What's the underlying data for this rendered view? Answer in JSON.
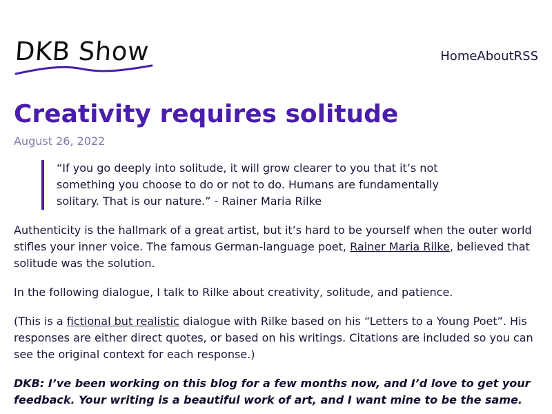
{
  "site": {
    "logo_text": "DKB Show",
    "accent_color": "#4a1dab",
    "text_color": "#1b1639",
    "muted_color": "#8577a8"
  },
  "nav": {
    "home": "Home",
    "about": "About",
    "rss": "RSS"
  },
  "post": {
    "title": "Creativity requires solitude",
    "date": "August 26, 2022",
    "quote": "“If you go deeply into solitude, it will grow clearer to you that it’s not something you choose to do or not to do. Humans are fundamentally solitary. That is our nature.” - Rainer Maria Rilke",
    "p1": {
      "before": "Authenticity is the hallmark of a great artist, but it’s hard to be yourself when the outer world stifles your inner voice. The famous German-language poet, ",
      "link": "Rainer Maria Rilke",
      "after": ", believed that solitude was the solution."
    },
    "p2": "In the following dialogue, I talk to Rilke about creativity, solitude, and patience.",
    "p3": {
      "before": "(This is a ",
      "link": "fictional but realistic",
      "after": " dialogue with Rilke based on his “Letters to a Young Poet”. His responses are either direct quotes, or based on his writings. Citations are included so you can see the original context for each response.)"
    },
    "p4": "DKB: I’ve been working on this blog for a few months now, and I’d love to get your feedback. Your writing is a beautiful work of art, and I want mine to be the same."
  }
}
